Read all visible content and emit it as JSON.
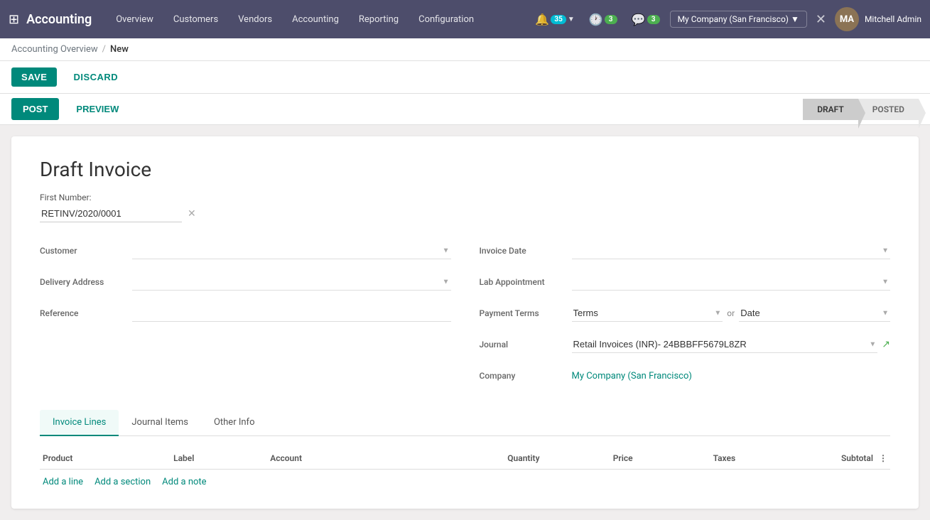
{
  "app": {
    "brand": "Accounting",
    "grid_icon": "⊞"
  },
  "topnav": {
    "menu_items": [
      "Overview",
      "Customers",
      "Vendors",
      "Accounting",
      "Reporting",
      "Configuration"
    ],
    "bell_badge": "35",
    "activity_badge": "3",
    "company_label": "My Company (San Francisco)",
    "username": "Mitchell Admin"
  },
  "breadcrumb": {
    "parent": "Accounting Overview",
    "separator": "/",
    "current": "New"
  },
  "action_bar": {
    "save_label": "SAVE",
    "discard_label": "DISCARD"
  },
  "status_bar": {
    "post_label": "POST",
    "preview_label": "PREVIEW",
    "stages": [
      "DRAFT",
      "POSTED"
    ]
  },
  "form": {
    "title": "Draft Invoice",
    "first_number_label": "First Number:",
    "first_number_value": "RETINV/2020/0001",
    "left_fields": [
      {
        "label": "Customer",
        "type": "select",
        "value": ""
      },
      {
        "label": "Delivery Address",
        "type": "select",
        "value": ""
      },
      {
        "label": "Reference",
        "type": "input",
        "value": ""
      }
    ],
    "right_fields": [
      {
        "label": "Invoice Date",
        "type": "select",
        "value": ""
      },
      {
        "label": "Lab Appointment",
        "type": "select",
        "value": ""
      },
      {
        "label": "Payment Terms",
        "type": "terms-date",
        "terms_placeholder": "Terms",
        "date_placeholder": "Date"
      },
      {
        "label": "Journal",
        "type": "journal",
        "value": "Retail Invoices (INR)- 24BBBFF5679L8ZR"
      },
      {
        "label": "Company",
        "type": "link",
        "value": "My Company (San Francisco)"
      }
    ]
  },
  "tabs": [
    {
      "id": "invoice-lines",
      "label": "Invoice Lines",
      "active": true
    },
    {
      "id": "journal-items",
      "label": "Journal Items",
      "active": false
    },
    {
      "id": "other-info",
      "label": "Other Info",
      "active": false
    }
  ],
  "table": {
    "columns": [
      "Product",
      "Label",
      "Account",
      "Quantity",
      "Price",
      "Taxes",
      "Subtotal"
    ],
    "actions": [
      "Add a line",
      "Add a section",
      "Add a note"
    ],
    "settings_icon": "⋮"
  }
}
